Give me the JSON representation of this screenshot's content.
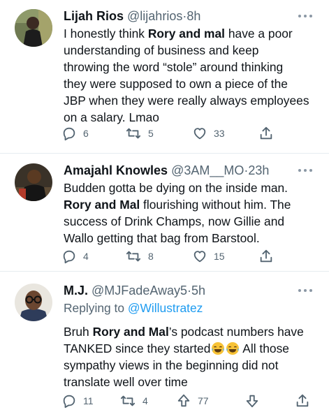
{
  "tweets": [
    {
      "name": "Lijah Rios",
      "handle": "@lijahrios",
      "separator": "·",
      "time": "8h",
      "lines": [
        [
          "I honestly think ",
          "Rory and mal",
          " have a poor"
        ],
        [
          "understanding of business and keep"
        ],
        [
          "throwing the word “stole” around thinking"
        ],
        [
          "they were supposed to own a piece of the"
        ],
        [
          "JBP when they were really always employees"
        ],
        [
          "on a salary. Lmao"
        ]
      ],
      "reply_count": "6",
      "retweet_count": "5",
      "like_count": "33"
    },
    {
      "name": "Amajahl Knowles",
      "handle": "@3AM__MO",
      "separator": "·",
      "time": "23h",
      "lines": [
        [
          "Budden gotta be dying on the inside man."
        ],
        [
          "Rory and Mal",
          " flourishing without him. The"
        ],
        [
          "success of Drink Champs, now Gillie and"
        ],
        [
          "Wallo getting that bag from Barstool."
        ]
      ],
      "reply_count": "4",
      "retweet_count": "8",
      "like_count": "15"
    },
    {
      "name": "M.J.",
      "handle": "@MJFadeAway5",
      "separator": "·",
      "time": "5h",
      "replying_label": "Replying to",
      "replying_to": "@Willustratez",
      "lines": [
        [
          "Bruh ",
          "Rory and Mal",
          "’s podcast numbers have"
        ],
        [
          "TANKED since they started",
          " All those"
        ],
        [
          "sympathy views in the beginning did not"
        ],
        [
          "translate well over time"
        ]
      ],
      "emoji": "crying-laughing-emoji",
      "reply_count": "11",
      "retweet_count": "4",
      "upvote_count": "77"
    }
  ],
  "colors": {
    "text": "#0f1419",
    "secondary": "#536471",
    "link": "#1d9bf0",
    "divider": "#e6ecf0"
  }
}
